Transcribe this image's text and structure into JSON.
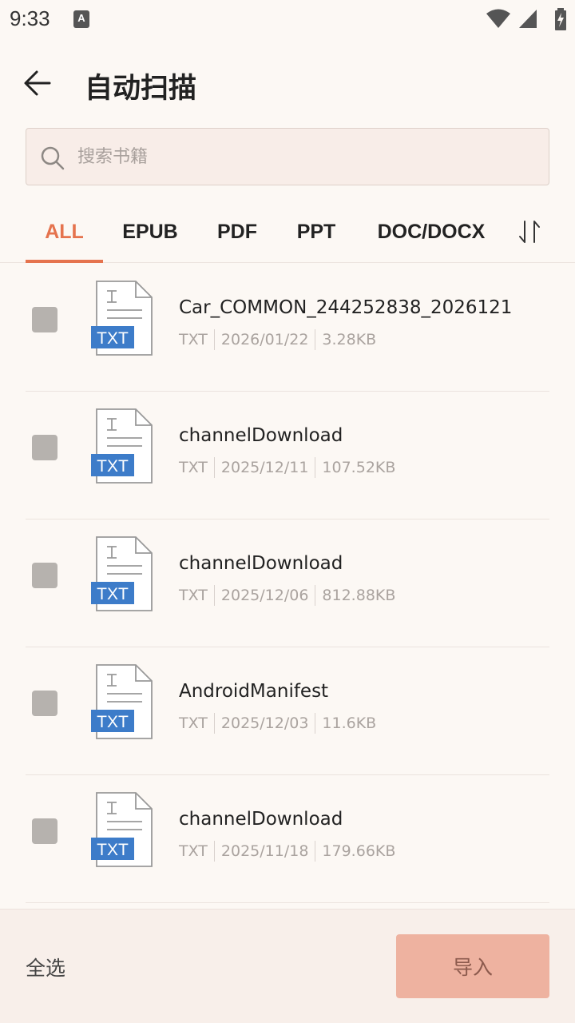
{
  "status_bar": {
    "time": "9:33",
    "notification_glyph": "A"
  },
  "header": {
    "title": "自动扫描"
  },
  "search": {
    "placeholder": "搜索书籍"
  },
  "tabs": [
    {
      "label": "ALL",
      "active": true
    },
    {
      "label": "EPUB",
      "active": false
    },
    {
      "label": "PDF",
      "active": false
    },
    {
      "label": "PPT",
      "active": false
    },
    {
      "label": "DOC/DOCX",
      "active": false
    }
  ],
  "files": [
    {
      "name": "Car_COMMON_244252838_2026121",
      "type": "TXT",
      "date": "2026/01/22",
      "size": "3.28KB",
      "icon_label": "TXT",
      "checked": false
    },
    {
      "name": "channelDownload",
      "type": "TXT",
      "date": "2025/12/11",
      "size": "107.52KB",
      "icon_label": "TXT",
      "checked": false
    },
    {
      "name": "channelDownload",
      "type": "TXT",
      "date": "2025/12/06",
      "size": "812.88KB",
      "icon_label": "TXT",
      "checked": false
    },
    {
      "name": "AndroidManifest",
      "type": "TXT",
      "date": "2025/12/03",
      "size": "11.6KB",
      "icon_label": "TXT",
      "checked": false
    },
    {
      "name": "channelDownload",
      "type": "TXT",
      "date": "2025/11/18",
      "size": "179.66KB",
      "icon_label": "TXT",
      "checked": false
    }
  ],
  "bottom": {
    "select_all": "全选",
    "import": "导入"
  },
  "colors": {
    "accent": "#e5734e",
    "file_badge": "#3d7cc9",
    "import_button": "#eeb2a0"
  },
  "icons": {
    "back": "arrow-left-icon",
    "search": "search-icon",
    "sort": "sort-icon",
    "file": "txt-file-icon"
  }
}
